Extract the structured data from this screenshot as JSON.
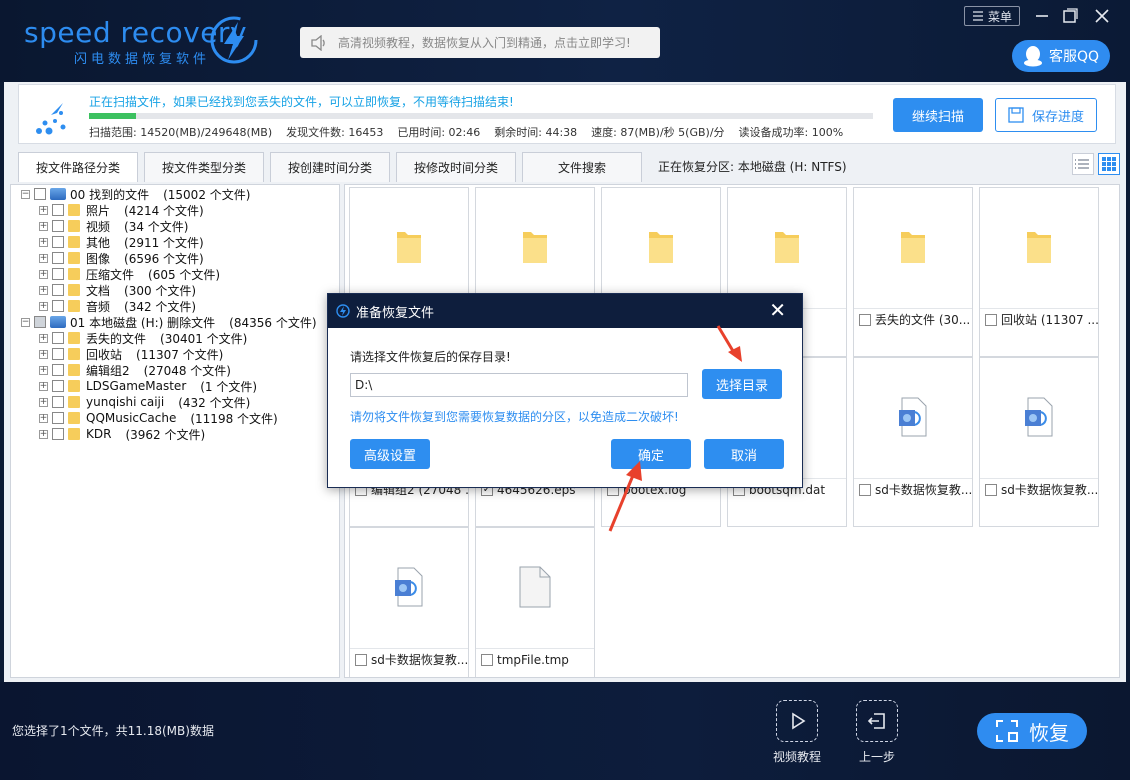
{
  "header": {
    "logo_text": "speed recovery",
    "logo_subtitle": "闪电数据恢复软件",
    "search_text": "高清视频教程，数据恢复从入门到精通，点击立即学习!",
    "menu_label": "菜单",
    "support_label": "客服QQ"
  },
  "scan": {
    "status": "正在扫描文件，如果已经找到您丢失的文件，可以立即恢复，不用等待扫描结束!",
    "progress": 0.06,
    "range": "扫描范围: 14520(MB)/249648(MB)",
    "found": "发现文件数: 16453",
    "elapsed": "已用时间: 02:46",
    "remaining": "剩余时间: 44:38",
    "speed": "速度: 87(MB)/秒 5(GB)/分",
    "success_rate": "读设备成功率: 100%",
    "continue_label": "继续扫描",
    "save_label": "保存进度"
  },
  "tabs": [
    {
      "label": "按文件路径分类",
      "active": true
    },
    {
      "label": "按文件类型分类",
      "active": false
    },
    {
      "label": "按创建时间分类",
      "active": false
    },
    {
      "label": "按修改时间分类",
      "active": false
    },
    {
      "label": "文件搜索",
      "active": false
    }
  ],
  "partition": "正在恢复分区: 本地磁盘 (H: NTFS)",
  "tree": [
    {
      "label": "00 找到的文件",
      "count": "(15002 个文件)",
      "level": 0
    },
    {
      "label": "照片",
      "count": "(4214 个文件)",
      "level": 1
    },
    {
      "label": "视频",
      "count": "(34 个文件)",
      "level": 1
    },
    {
      "label": "其他",
      "count": "(2911 个文件)",
      "level": 1
    },
    {
      "label": "图像",
      "count": "(6596 个文件)",
      "level": 1
    },
    {
      "label": "压缩文件",
      "count": "(605 个文件)",
      "level": 1
    },
    {
      "label": "文档",
      "count": "(300 个文件)",
      "level": 1
    },
    {
      "label": "音频",
      "count": "(342 个文件)",
      "level": 1
    },
    {
      "label": "01 本地磁盘 (H:) 删除文件",
      "count": "(84356 个文件)",
      "level": 0
    },
    {
      "label": "丢失的文件",
      "count": "(30401 个文件)",
      "level": 1
    },
    {
      "label": "回收站",
      "count": "(11307 个文件)",
      "level": 1
    },
    {
      "label": "编辑组2",
      "count": "(27048 个文件)",
      "level": 1
    },
    {
      "label": "LDSGameMaster",
      "count": "(1 个文件)",
      "level": 1
    },
    {
      "label": "yunqishi caiji",
      "count": "(432 个文件)",
      "level": 1
    },
    {
      "label": "QQMusicCache",
      "count": "(11198 个文件)",
      "level": 1
    },
    {
      "label": "KDR",
      "count": "(3962 个文件)",
      "level": 1
    }
  ],
  "files": [
    {
      "name": "",
      "type": "folder"
    },
    {
      "name": "",
      "type": "folder"
    },
    {
      "name": "",
      "type": "folder"
    },
    {
      "name": "i (43...",
      "type": "folder"
    },
    {
      "name": "丢失的文件 (30...",
      "type": "folder"
    },
    {
      "name": "回收站 (11307 ...",
      "type": "folder"
    },
    {
      "name": "编辑组2 (27048 ...",
      "type": "hidden"
    },
    {
      "name": "4645626.eps",
      "type": "hidden",
      "checked": true
    },
    {
      "name": "bootex.log",
      "type": "hidden"
    },
    {
      "name": "bootsqm.dat",
      "type": "hidden"
    },
    {
      "name": "sd卡数据恢复教...",
      "type": "video"
    },
    {
      "name": "sd卡数据恢复教...",
      "type": "video"
    },
    {
      "name": "sd卡数据恢复教...",
      "type": "video"
    },
    {
      "name": "tmpFile.tmp",
      "type": "file"
    }
  ],
  "dialog": {
    "title": "准备恢复文件",
    "label": "请选择文件恢复后的保存目录!",
    "path": "D:\\",
    "browse_label": "选择目录",
    "warning": "请勿将文件恢复到您需要恢复数据的分区，以免造成二次破坏!",
    "advanced_label": "高级设置",
    "ok_label": "确定",
    "cancel_label": "取消"
  },
  "footer": {
    "selection": "您选择了1个文件，共11.18(MB)数据",
    "tutorial_label": "视频教程",
    "back_label": "上一步",
    "restore_label": "恢复"
  },
  "colors": {
    "accent": "#2e8ef0",
    "header_bg": "#0e1e3d",
    "annotation": "#e8412c"
  }
}
